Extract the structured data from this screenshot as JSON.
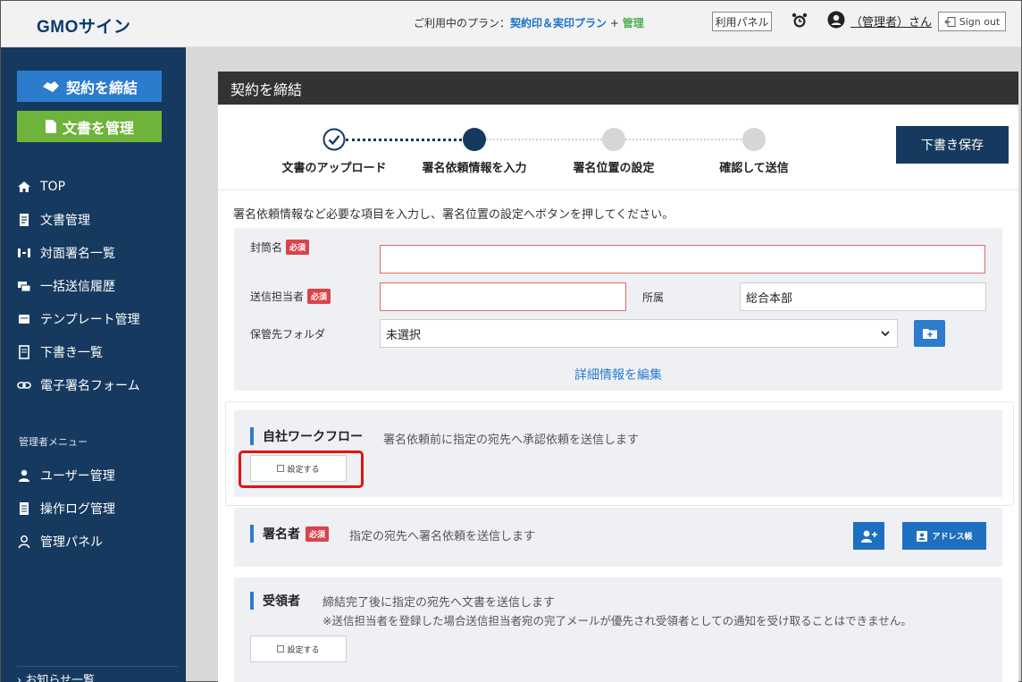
{
  "header": {
    "logo": "GMOサイン",
    "plan_prefix": "ご利用中のプラン：",
    "plan_name": "契約印＆実印プラン",
    "plan_plus": " + ",
    "plan_admin": "管理",
    "admin_panel_button": "利用パネル",
    "user_name": "（管理者）さん",
    "signout": "Sign out"
  },
  "sidebar": {
    "contract_button": "契約を締結",
    "manage_button": "文書を管理",
    "items": [
      {
        "label": "TOP",
        "icon": "home-icon"
      },
      {
        "label": "文書管理",
        "icon": "document-icon"
      },
      {
        "label": "対面署名一覧",
        "icon": "face-to-face-icon"
      },
      {
        "label": "一括送信履歴",
        "icon": "batch-send-icon"
      },
      {
        "label": "テンプレート管理",
        "icon": "template-icon"
      },
      {
        "label": "下書き一覧",
        "icon": "draft-icon"
      },
      {
        "label": "電子署名フォーム",
        "icon": "link-icon"
      }
    ],
    "admin_section": "管理者メニュー",
    "admin_items": [
      {
        "label": "ユーザー管理",
        "icon": "user-icon"
      },
      {
        "label": "操作ログ管理",
        "icon": "log-icon"
      },
      {
        "label": "管理パネル",
        "icon": "admin-panel-icon"
      }
    ],
    "news": "お知らせ一覧"
  },
  "main": {
    "title": "契約を締結",
    "steps": [
      {
        "label": "文書のアップロード",
        "state": "done"
      },
      {
        "label": "署名依頼情報を入力",
        "state": "current"
      },
      {
        "label": "署名位置の設定",
        "state": "todo"
      },
      {
        "label": "確認して送信",
        "state": "todo"
      }
    ],
    "draft_save_button": "下書き保存",
    "instruction": "署名依頼情報など必要な項目を入力し、署名位置の設定へボタンを押してください。",
    "form": {
      "envelope_label": "封筒名",
      "envelope_value": "",
      "sender_label": "送信担当者",
      "sender_value": "",
      "affiliation_label": "所属",
      "affiliation_value": "総合本部",
      "folder_label": "保管先フォルダ",
      "folder_value": "未選択",
      "required_badge": "必須",
      "detail_link": "詳細情報を編集"
    },
    "workflow": {
      "title": "自社ワークフロー",
      "description": "署名依頼前に指定の宛先へ承認依頼を送信します",
      "set_button": "設定する"
    },
    "signer": {
      "title": "署名者",
      "description": "指定の宛先へ署名依頼を送信します",
      "address_book_button": "アドレス帳"
    },
    "recipient": {
      "title": "受領者",
      "description": "締結完了後に指定の宛先へ文書を送信します",
      "note": "※送信担当者を登録した場合送信担当者宛の完了メールが優先され受領者としての通知を受け取ることはできません。",
      "set_button": "設定する"
    }
  },
  "colors": {
    "sidebar": "#163a5f",
    "accent": "#2b7ccc",
    "green": "#6fb43a",
    "required": "#d9434b",
    "highlight": "#e21313"
  }
}
